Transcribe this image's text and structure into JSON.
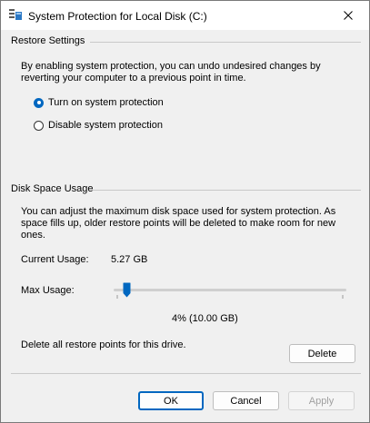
{
  "window": {
    "title": "System Protection for Local Disk (C:)"
  },
  "restore_settings": {
    "group_title": "Restore Settings",
    "description_line1": "By enabling system protection, you can undo undesired changes by",
    "description_line2": "reverting your computer to a previous point in time.",
    "options": [
      {
        "label": "Turn on system protection",
        "selected": true
      },
      {
        "label": "Disable system protection",
        "selected": false
      }
    ]
  },
  "disk_space": {
    "group_title": "Disk Space Usage",
    "description_line1": "You can adjust the maximum disk space used for system protection. As",
    "description_line2": "space fills up, older restore points will be deleted to make room for new",
    "description_line3": "ones.",
    "current_usage_label": "Current Usage:",
    "current_usage_value": "5.27 GB",
    "max_usage_label": "Max Usage:",
    "max_usage_fraction": 0.04,
    "max_usage_value": "4% (10.00 GB)",
    "delete_description": "Delete all restore points for this drive.",
    "delete_button": "Delete"
  },
  "footer": {
    "ok": "OK",
    "cancel": "Cancel",
    "apply": "Apply"
  },
  "colors": {
    "accent": "#0067c0"
  },
  "icons": {
    "title": "system-protection-icon",
    "close": "close-icon"
  }
}
